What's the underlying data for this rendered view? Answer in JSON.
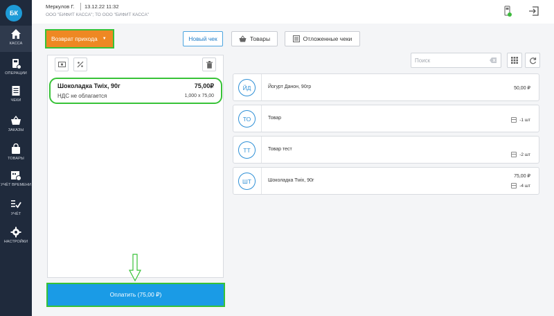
{
  "sidebar": {
    "avatar": "БК",
    "items": [
      {
        "label": "КАССА",
        "icon": "home-icon"
      },
      {
        "label": "ОПЕРАЦИИ",
        "icon": "operations-icon"
      },
      {
        "label": "ЧЕКИ",
        "icon": "receipts-icon"
      },
      {
        "label": "ЗАКАЗЫ",
        "icon": "basket-icon"
      },
      {
        "label": "ТОВАРЫ",
        "icon": "bag-icon"
      },
      {
        "label": "УЧЁТ ВРЕМЕНИ",
        "icon": "time-tracking-icon"
      },
      {
        "label": "УЧЁТ",
        "icon": "accounting-icon"
      },
      {
        "label": "НАСТРОЙКИ",
        "icon": "gear-icon"
      }
    ]
  },
  "header": {
    "user": "Меркулов Г.",
    "datetime": "13.12.22 11:32",
    "org": "ООО \"БИФИТ КАССА\"; ТО ООО \"БИФИТ КАССА\"",
    "icons": [
      "cash-register-icon",
      "exit-icon"
    ]
  },
  "toolbar": {
    "operation_mode": "Возврат прихода",
    "new_receipt": "Новый чек",
    "goods": "Товары",
    "deferred": "Отложенные чеки"
  },
  "receipt": {
    "item": {
      "name": "Шоколадка Twix, 90г",
      "price": "75,00₽",
      "vat": "НДС не облагается",
      "qty": "1,000 x 75,00"
    },
    "pay_button": "Оплатить (75,00 ₽)"
  },
  "search": {
    "placeholder": "Поиск"
  },
  "products": [
    {
      "initials": "ЙД",
      "name": "Йогурт Данон, 90гр",
      "price": "50,00 ₽",
      "stock": ""
    },
    {
      "initials": "ТО",
      "name": "Товар",
      "price": "",
      "stock": "-1 шт"
    },
    {
      "initials": "ТТ",
      "name": "Товар тест",
      "price": "",
      "stock": "-2 шт"
    },
    {
      "initials": "ШТ",
      "name": "Шоколадка Twix, 90г",
      "price": "75,00 ₽",
      "stock": "-4 шт"
    }
  ],
  "colors": {
    "sidebar": "#1f2a3c",
    "accent_orange": "#ee8823",
    "accent_blue": "#1a9be6",
    "highlight_green": "#37c237"
  }
}
